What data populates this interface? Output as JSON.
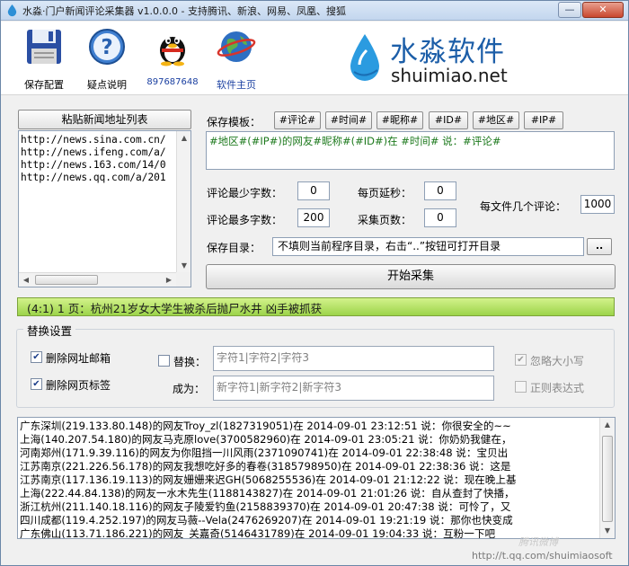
{
  "window": {
    "title": "水淼·门户新闻评论采集器 v1.0.0.0 - 支持腾讯、新浪、网易、凤凰、搜狐",
    "minimize_glyph": "—",
    "close_glyph": "✕"
  },
  "toolbar": {
    "save": "保存配置",
    "help": "疑点说明",
    "qq": "897687648",
    "home": "软件主页"
  },
  "logo": {
    "cn": "水淼软件",
    "en": "shuimiao.net"
  },
  "url_panel": {
    "button": "粘贴新闻地址列表",
    "urls": [
      "http://news.sina.com.cn/",
      "http://news.ifeng.com/a/",
      "http://news.163.com/14/0",
      "http://news.qq.com/a/201"
    ]
  },
  "template": {
    "label": "保存模板：",
    "tags": [
      "#评论#",
      "#时间#",
      "#昵称#",
      "#ID#",
      "#地区#",
      "#IP#"
    ],
    "value": "#地区#(#IP#)的网友#昵称#(#ID#)在 #时间# 说：#评论#"
  },
  "settings": {
    "min_chars_label": "评论最少字数：",
    "min_chars": "0",
    "max_chars_label": "评论最多字数：",
    "max_chars": "200",
    "page_delay_label": "每页延秒：",
    "page_delay": "0",
    "pages_label": "采集页数：",
    "pages": "0",
    "per_file_label": "每文件几个评论：",
    "per_file": "1000",
    "dir_label": "保存目录：",
    "dir_value": "不填则当前程序目录，右击“..”按钮可打开目录",
    "dir_button": "..",
    "start_button": "开始采集"
  },
  "progress": {
    "text": "(4:1) 1 页：杭州21岁女大学生被杀后抛尸水井 凶手被抓获",
    "fraction": 1.0
  },
  "replace": {
    "title": "替换设置",
    "remove_url_mail": "删除网址邮箱",
    "remove_url_mail_checked": true,
    "remove_html": "删除网页标签",
    "remove_html_checked": true,
    "replace_label": "替换：",
    "replace_checked": false,
    "replace_value": "字符1|字符2|字符3",
    "to_label": "成为：",
    "to_value": "新字符1|新字符2|新字符3",
    "ignore_case": "忽略大小写",
    "ignore_case_checked": true,
    "regex": "正则表达式",
    "regex_checked": false
  },
  "log": [
    "广东深圳(219.133.80.148)的网友Troy_zl(1827319051)在 2014-09-01 23:12:51 说：你很安全的~~",
    "上海(140.207.54.180)的网友马克原love(3700582960)在 2014-09-01 23:05:21 说：你奶奶我健在，",
    "河南郑州(171.9.39.116)的网友为你阻挡一川风雨(2371090741)在 2014-09-01 22:38:48 说：宝贝出",
    "江苏南京(221.226.56.178)的网友我想吃好多的春卷(3185798950)在 2014-09-01 22:38:36 说：这是",
    "江苏南京(117.136.19.113)的网友姗姗来迟GH(5068255536)在 2014-09-01 21:12:22 说：现在晚上基",
    "上海(222.44.84.138)的网友一水木先生(1188143827)在 2014-09-01 21:01:26 说：自从查封了快播，",
    "浙江杭州(211.140.18.116)的网友子陵爱钓鱼(2158839370)在 2014-09-01 20:47:38 说：可怜了，又",
    "四川成都(119.4.252.197)的网友马薇--Vela(2476269207)在 2014-09-01 19:21:19 说：那你也快变成",
    "广东佛山(113.71.186.221)的网友_关嘉奇(5146431789)在 2014-09-01 19:04:33 说：互粉一下吧"
  ],
  "watermark": {
    "brand": "腾讯微博",
    "url": "http://t.qq.com/shuimiaosoft"
  },
  "colors": {
    "logo_blue": "#1c5ea8",
    "template_green": "#1e7a1e",
    "progress_green": "#9cd44a"
  }
}
